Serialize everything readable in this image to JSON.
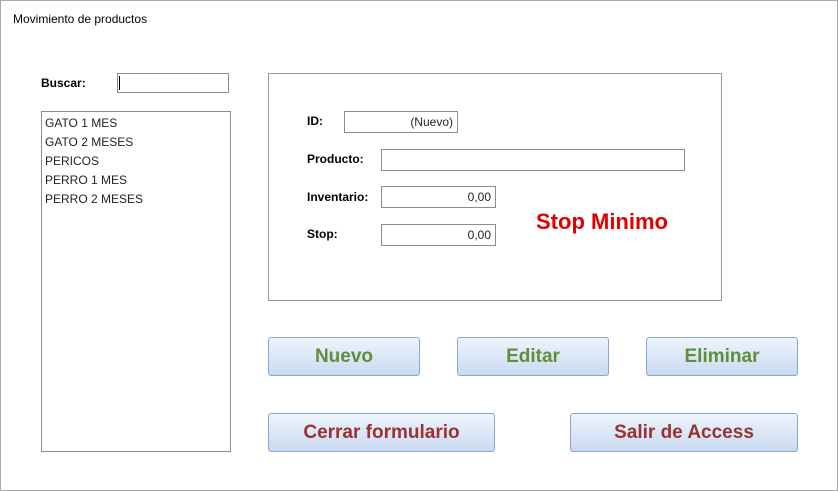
{
  "form": {
    "title": "Movimiento de productos"
  },
  "search": {
    "label": "Buscar:",
    "value": ""
  },
  "products": {
    "items": [
      "GATO 1 MES",
      "GATO 2 MESES",
      "PERICOS",
      "PERRO 1 MES",
      "PERRO 2 MESES"
    ]
  },
  "detail": {
    "id_label": "ID:",
    "id_value": "(Nuevo)",
    "producto_label": "Producto:",
    "producto_value": "",
    "inventario_label": "Inventario:",
    "inventario_value": "0,00",
    "stop_label": "Stop:",
    "stop_value": "0,00",
    "stop_minimo": "Stop Minimo"
  },
  "buttons": {
    "nuevo": "Nuevo",
    "editar": "Editar",
    "eliminar": "Eliminar",
    "cerrar": "Cerrar formulario",
    "salir": "Salir de Access"
  },
  "colors": {
    "stop_minimo": "#e00000",
    "green_button_text": "#5f8f3a",
    "red_button_text": "#9b3232",
    "button_bg": "#c9daf1"
  }
}
